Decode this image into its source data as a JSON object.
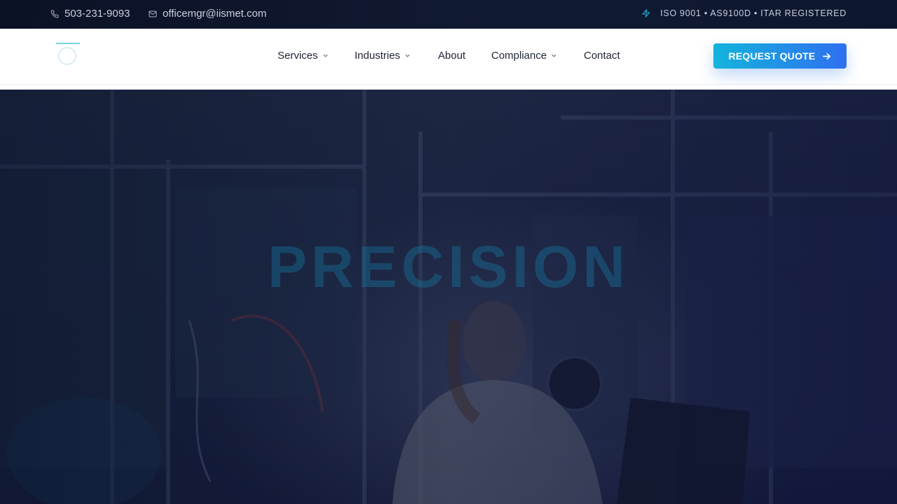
{
  "topbar": {
    "phone": "503-231-9093",
    "email": "officemgr@iismet.com",
    "certifications": "ISO 9001 • AS9100D • ITAR REGISTERED"
  },
  "nav": {
    "items": [
      {
        "label": "Services",
        "has_dropdown": true
      },
      {
        "label": "Industries",
        "has_dropdown": true
      },
      {
        "label": "About",
        "has_dropdown": false
      },
      {
        "label": "Compliance",
        "has_dropdown": true
      },
      {
        "label": "Contact",
        "has_dropdown": false
      }
    ],
    "cta_label": "REQUEST QUOTE"
  },
  "hero": {
    "title": "PRECISION"
  },
  "colors": {
    "accent": "#14b4dc",
    "accent_end": "#2f6ff0",
    "topbar_bg": "#0b1226",
    "hero_overlay": "#141b3a"
  },
  "icons": {
    "phone": "phone-icon",
    "email": "mail-icon",
    "cert": "lightning-icon",
    "dropdown": "chevron-down-icon",
    "cta": "arrow-right-icon"
  }
}
